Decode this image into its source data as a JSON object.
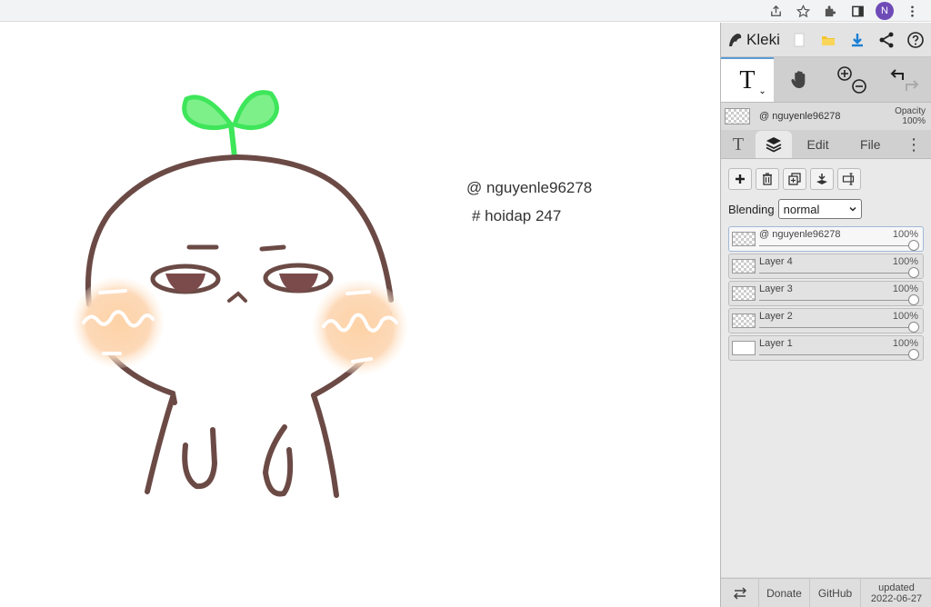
{
  "browser": {
    "profile_initial": "N"
  },
  "canvas": {
    "text_line_1": "@ nguyenle96278",
    "text_line_2": "# hoidap 247"
  },
  "panel": {
    "app_name": "Kleki",
    "layer_header": {
      "name": "@ nguyenle96278",
      "opacity_label": "Opacity",
      "opacity_value": "100%"
    },
    "tabs": {
      "edit": "Edit",
      "file": "File"
    },
    "blending": {
      "label": "Blending",
      "value": "normal"
    },
    "layers": [
      {
        "name": "@ nguyenle96278",
        "opacity": "100%"
      },
      {
        "name": "Layer 4",
        "opacity": "100%"
      },
      {
        "name": "Layer 3",
        "opacity": "100%"
      },
      {
        "name": "Layer 2",
        "opacity": "100%"
      },
      {
        "name": "Layer 1",
        "opacity": "100%"
      }
    ],
    "bottom": {
      "donate": "Donate",
      "github": "GitHub",
      "updated_label": "updated",
      "updated_date": "2022-06-27"
    }
  },
  "colors": {
    "accent": "#5b9bd5",
    "sprout": "#3ee65a",
    "outline": "#6b4a45",
    "blush": "#fdd6ad"
  }
}
